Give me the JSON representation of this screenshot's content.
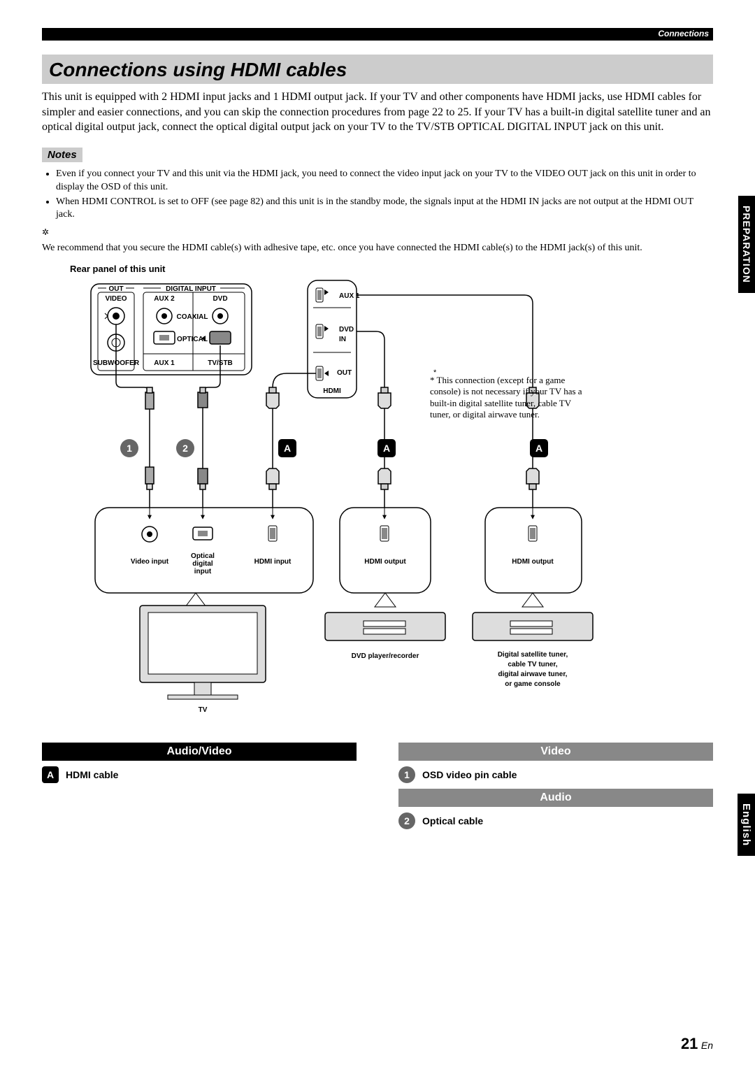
{
  "topbar": "Connections",
  "h1": "Connections using HDMI cables",
  "intro": "This unit is equipped with 2 HDMI input jacks and 1 HDMI output jack. If your TV and other components have HDMI jacks, use HDMI cables for simpler and easier connections, and you can skip the connection procedures from page 22 to 25. If your TV has a built-in digital satellite tuner and an optical digital output jack, connect the optical digital output jack on your TV to the TV/STB OPTICAL DIGITAL INPUT jack on this unit.",
  "notes_h": "Notes",
  "notes": {
    "n1": "Even if you connect your TV and this unit via the HDMI jack, you need to connect the video input jack on your TV to the VIDEO OUT jack on this unit in order to display the OSD of this unit.",
    "n2": "When HDMI CONTROL is set to OFF (see page 82) and this unit is in the standby mode, the signals input at the HDMI IN jacks are not output at the HDMI OUT jack."
  },
  "tip": "We recommend that you secure the HDMI cable(s) with adhesive tape, etc. once you have connected the HDMI cable(s) to the HDMI jack(s) of this unit.",
  "caption": "Rear panel of this unit",
  "aside": "*  This connection (except for a game console) is not necessary if your TV has a built-in digital satellite tuner, cable TV tuner, or digital airwave tuner.",
  "diagram": {
    "rear": {
      "out": "OUT",
      "video": "VIDEO",
      "subwoofer": "SUBWOOFER",
      "digital_input": "DIGITAL INPUT",
      "aux2": "AUX 2",
      "dvd": "DVD",
      "coaxial": "COAXIAL",
      "optical": "OPTICAL",
      "aux1": "AUX 1",
      "tvstb": "TV/STB"
    },
    "hdmi": {
      "aux1": "AUX 1",
      "dvd": "DVD",
      "in": "IN",
      "out": "OUT",
      "hdmi": "HDMI"
    },
    "markers": {
      "m1": "1",
      "m2": "2",
      "mA": "A"
    },
    "tv": {
      "video_input": "Video input",
      "optical": "Optical digital input",
      "hdmi_input": "HDMI input",
      "label": "TV"
    },
    "dvd": {
      "hdmi_output": "HDMI output",
      "label": "DVD player/recorder"
    },
    "sat": {
      "hdmi_output": "HDMI output",
      "label": "Digital satellite tuner, cable TV tuner, digital airwave tuner, or game console"
    }
  },
  "legend": {
    "av": "Audio/Video",
    "video": "Video",
    "audio": "Audio",
    "A": "HDMI cable",
    "one": "OSD video pin cable",
    "two": "Optical cable"
  },
  "sidetab": {
    "prep": "PREPARATION",
    "eng": "English"
  },
  "page": {
    "num": "21",
    "lang": "En"
  }
}
